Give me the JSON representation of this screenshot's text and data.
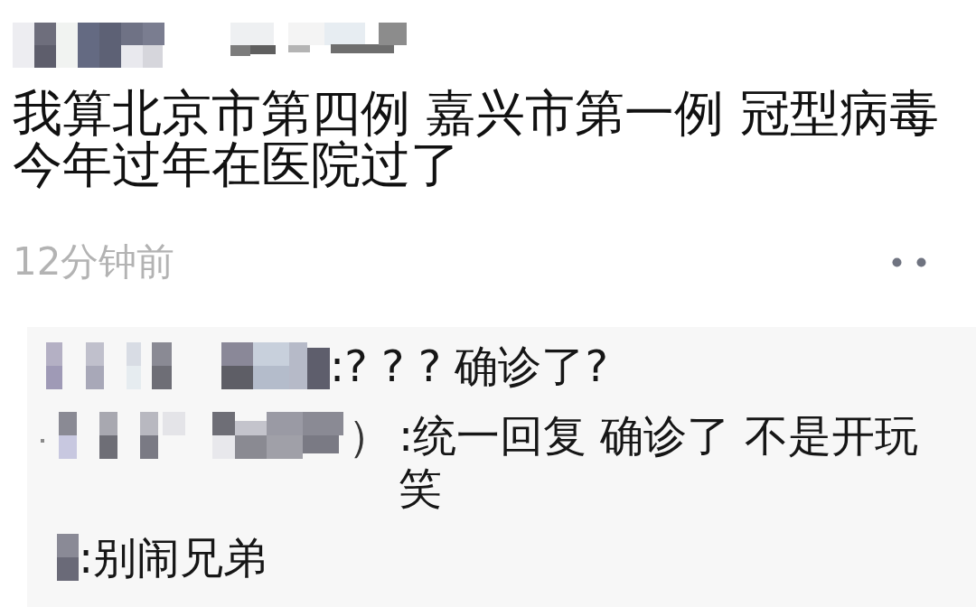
{
  "post": {
    "text": "我算北京市第四例 嘉兴市第一例 冠型病毒今年过年在医院过了",
    "time": "12分钟前"
  },
  "comments": [
    {
      "text": ":? ? ? 确诊了?"
    },
    {
      "name_tail": "）",
      "text": ":统一回复 确诊了 不是开玩笑"
    },
    {
      "text": ":别闹兄弟"
    }
  ]
}
